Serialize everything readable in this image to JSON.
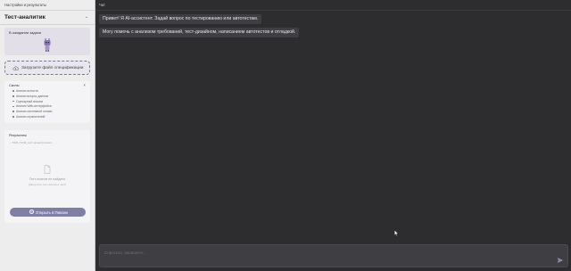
{
  "sidebar": {
    "header": "Настройки и результаты",
    "title": "Тест-аналитик",
    "collapse_icon": "chevron-down-icon",
    "status": {
      "label": "В ожидании задачи"
    },
    "upload": {
      "label": "Загрузите файл спецификации"
    },
    "skills": {
      "title": "Скилы",
      "close": "×",
      "items": [
        "Анализ ясности",
        "Анализ вопрос-данные",
        "Сценарный анализ",
        "Анализ Web-интерфейса",
        "Анализ системной логики",
        "Анализ ограничений"
      ]
    },
    "results": {
      "title": "Результаты",
      "file": "....ТЗ29_ТС30_тест-проект(1).docx",
      "empty_text": "Тест-планов не найдено",
      "empty_sub": "(Запустите тест-агента в чате)",
      "open_button": "Открыть в Пиксии",
      "open_icon": "plus-circle-icon"
    }
  },
  "chat": {
    "header": "Чат",
    "messages": [
      {
        "role": "assistant",
        "text": "Привет! Я AI-ассистент. Задай вопрос по тестированию или автотестам."
      },
      {
        "role": "assistant",
        "text": "Могу помочь с анализом требований, тест-дизайном, написанием автотестов и отладкой."
      }
    ],
    "input": {
      "value": "",
      "placeholder": "Спросите, напишите..."
    },
    "send_icon": "send-icon"
  },
  "colors": {
    "sidebar_bg": "#ededee",
    "main_bg": "#2d2d30",
    "accent": "#7f7fa6",
    "message_bg": "#3e3e43"
  }
}
